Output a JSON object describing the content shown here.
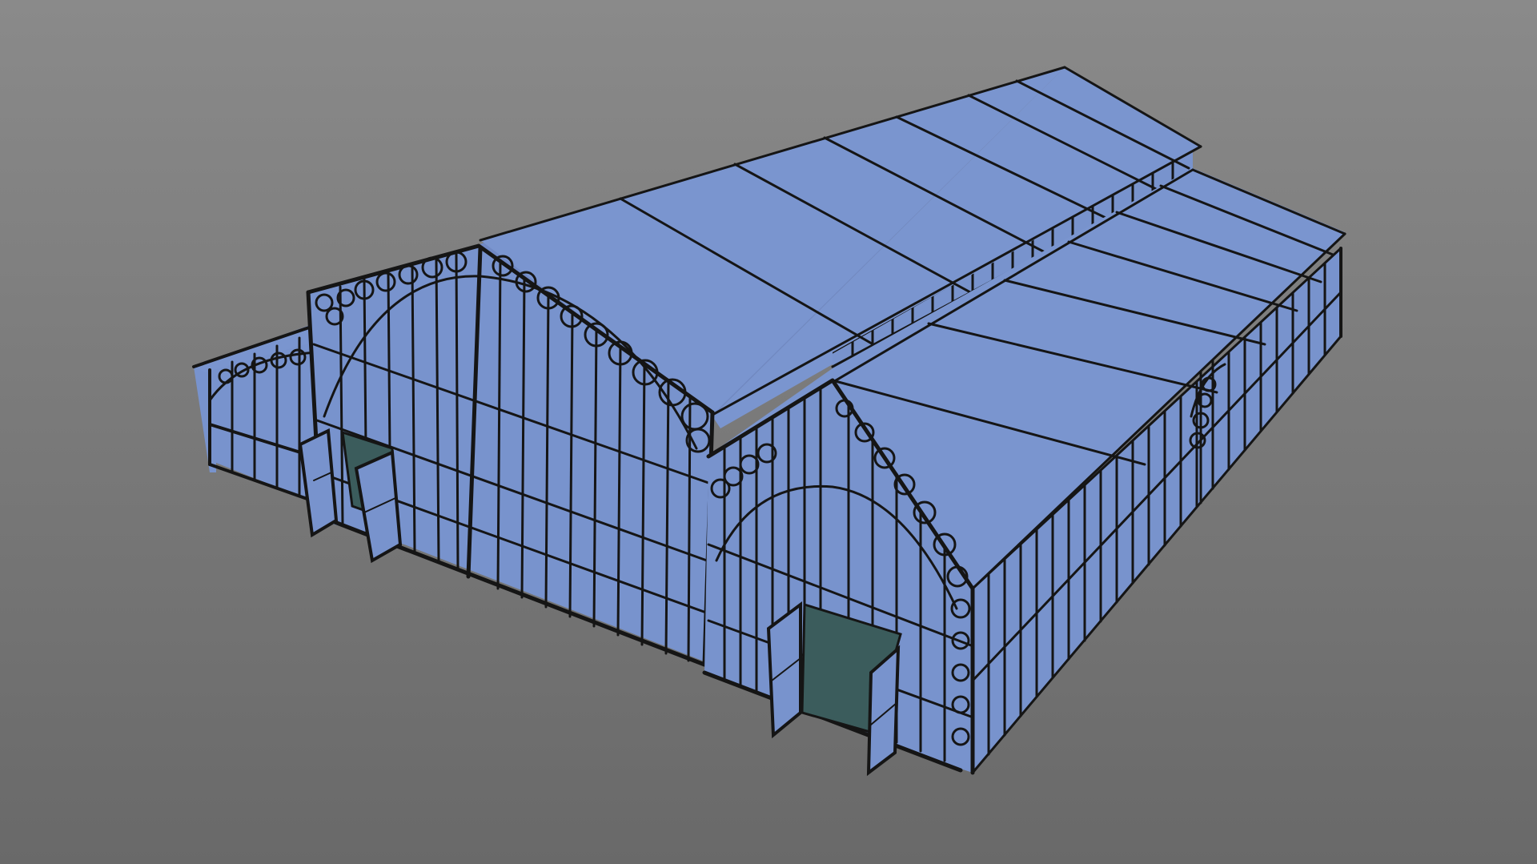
{
  "viewport": {
    "background_top": "#8a8a8a",
    "background_bottom": "#696969"
  },
  "model": {
    "object": "greenhouse-building",
    "glass_color": "#7893cd",
    "frame_color": "#151515",
    "door_opening_color": "#3b5c5c"
  }
}
